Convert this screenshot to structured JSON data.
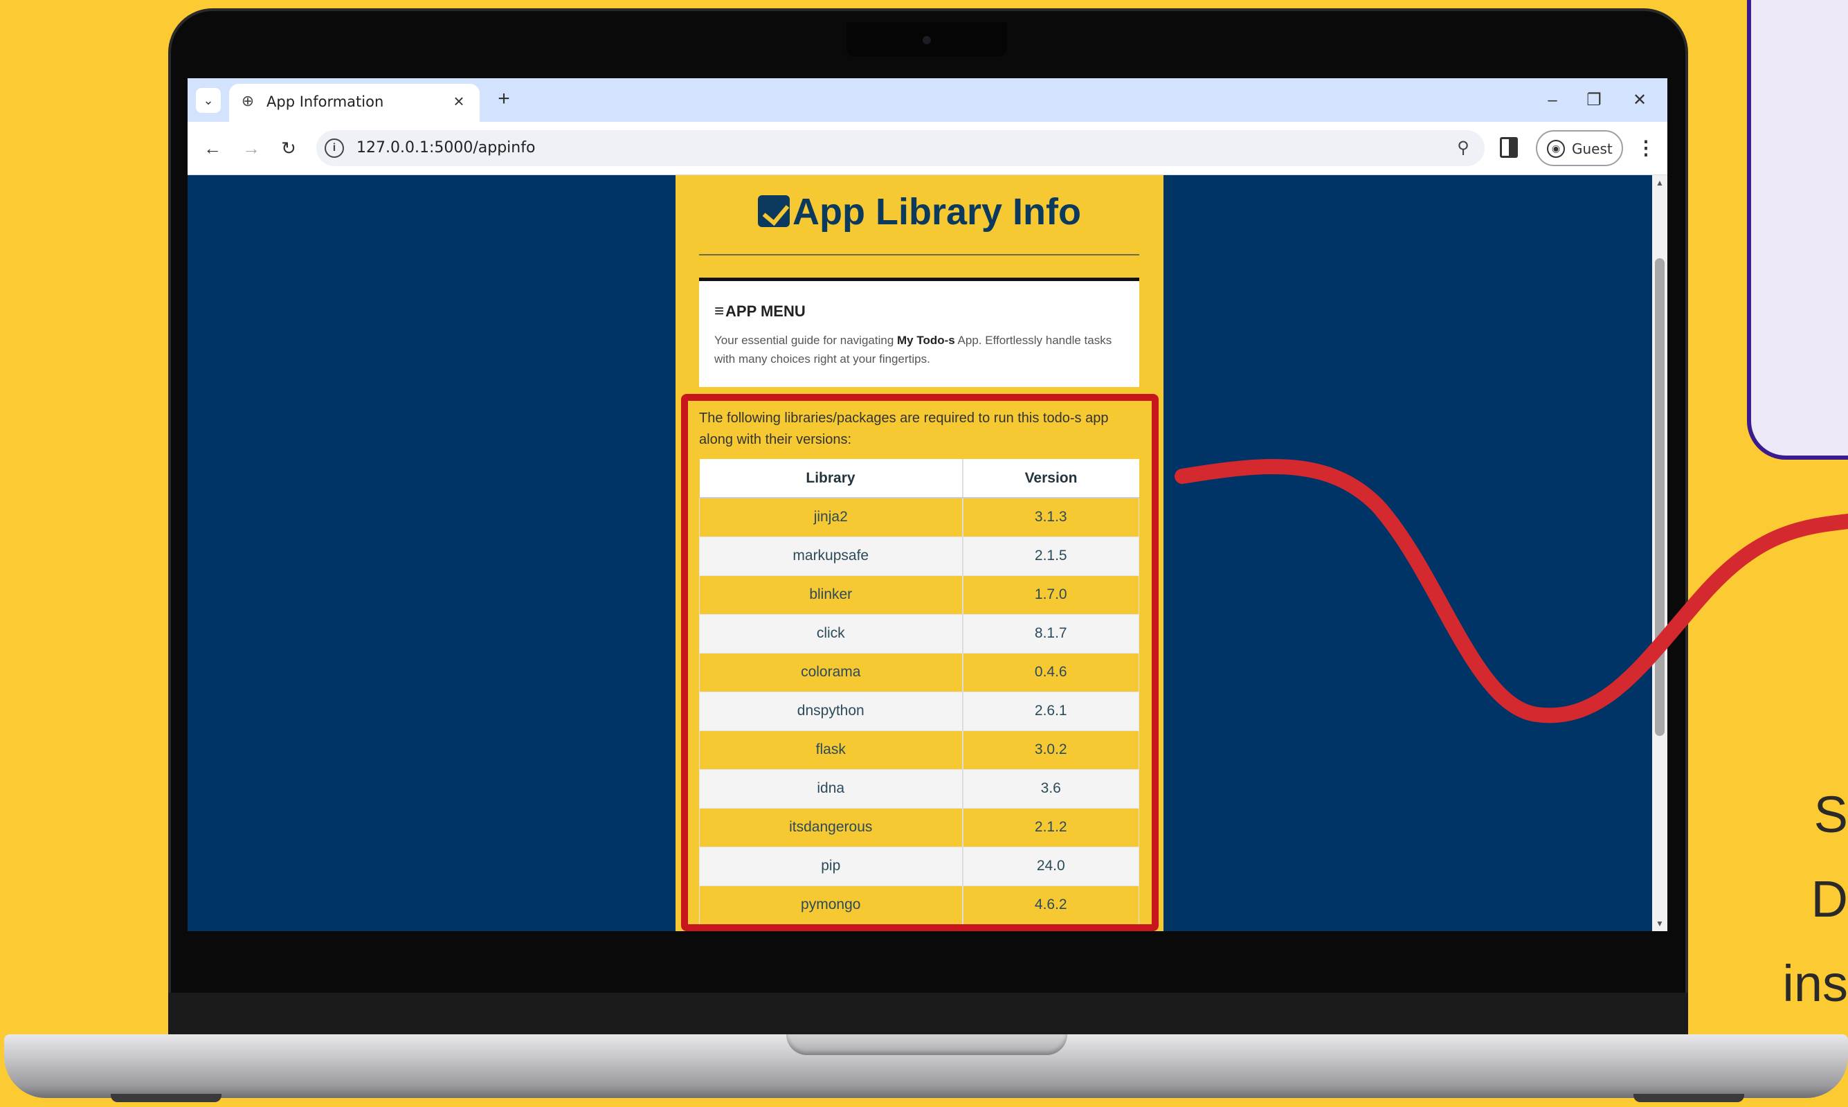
{
  "browser": {
    "tab_title": "App Information",
    "url": "127.0.0.1:5000/appinfo",
    "profile_label": "Guest"
  },
  "page": {
    "title": "App Library Info",
    "menu_heading": "APP MENU",
    "menu_desc_prefix": "Your essential guide for navigating ",
    "menu_desc_bold": "My Todo-s",
    "menu_desc_suffix": " App. Effortlessly handle tasks with many choices right at your fingertips.",
    "intro": "The following libraries/packages are required to run this todo-s app along with their versions:",
    "table": {
      "headers": [
        "Library",
        "Version"
      ],
      "rows": [
        [
          "jinja2",
          "3.1.3"
        ],
        [
          "markupsafe",
          "2.1.5"
        ],
        [
          "blinker",
          "1.7.0"
        ],
        [
          "click",
          "8.1.7"
        ],
        [
          "colorama",
          "0.4.6"
        ],
        [
          "dnspython",
          "2.6.1"
        ],
        [
          "flask",
          "3.0.2"
        ],
        [
          "idna",
          "3.6"
        ],
        [
          "itsdangerous",
          "2.1.2"
        ],
        [
          "pip",
          "24.0"
        ],
        [
          "pymongo",
          "4.6.2"
        ]
      ]
    }
  },
  "side_text": [
    "S",
    "D",
    "ins"
  ],
  "colors": {
    "background": "#fccb33",
    "page_bg": "#003366",
    "card_bg": "#f6c932",
    "highlight": "#c8161d",
    "curve": "#d42a2f"
  }
}
